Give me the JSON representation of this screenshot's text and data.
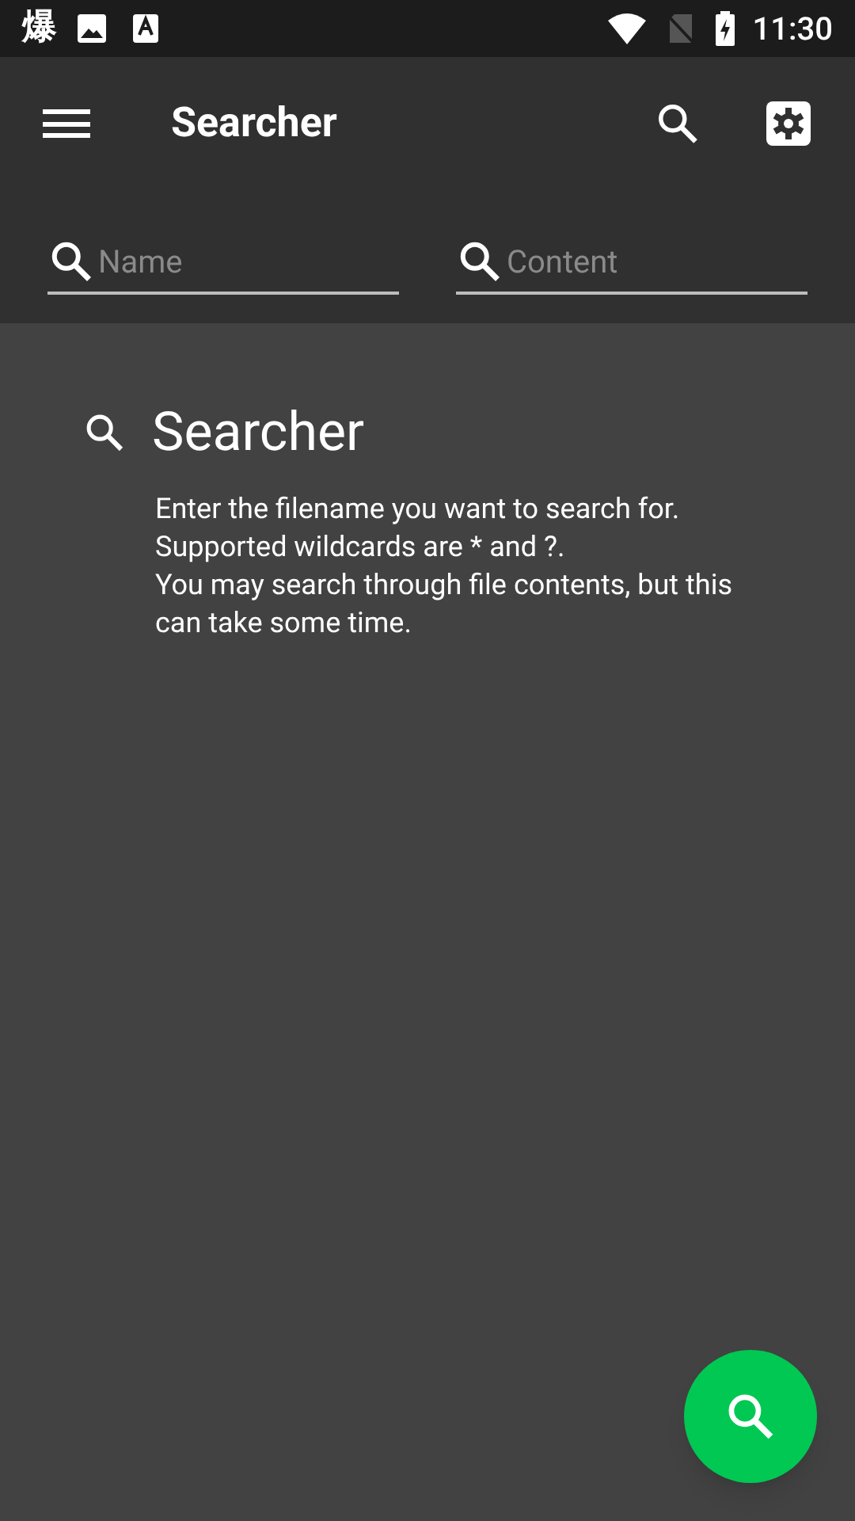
{
  "status_bar": {
    "notification_glyph": "爆",
    "time": "11:30"
  },
  "app_bar": {
    "title": "Searcher"
  },
  "search_fields": [
    {
      "placeholder": "Name"
    },
    {
      "placeholder": "Content"
    }
  ],
  "empty_state": {
    "title": "Searcher",
    "lines": [
      "Enter the filename you want to search for.",
      "Supported wildcards are * and ?.",
      "You may search through file contents, but this can take some time."
    ]
  }
}
